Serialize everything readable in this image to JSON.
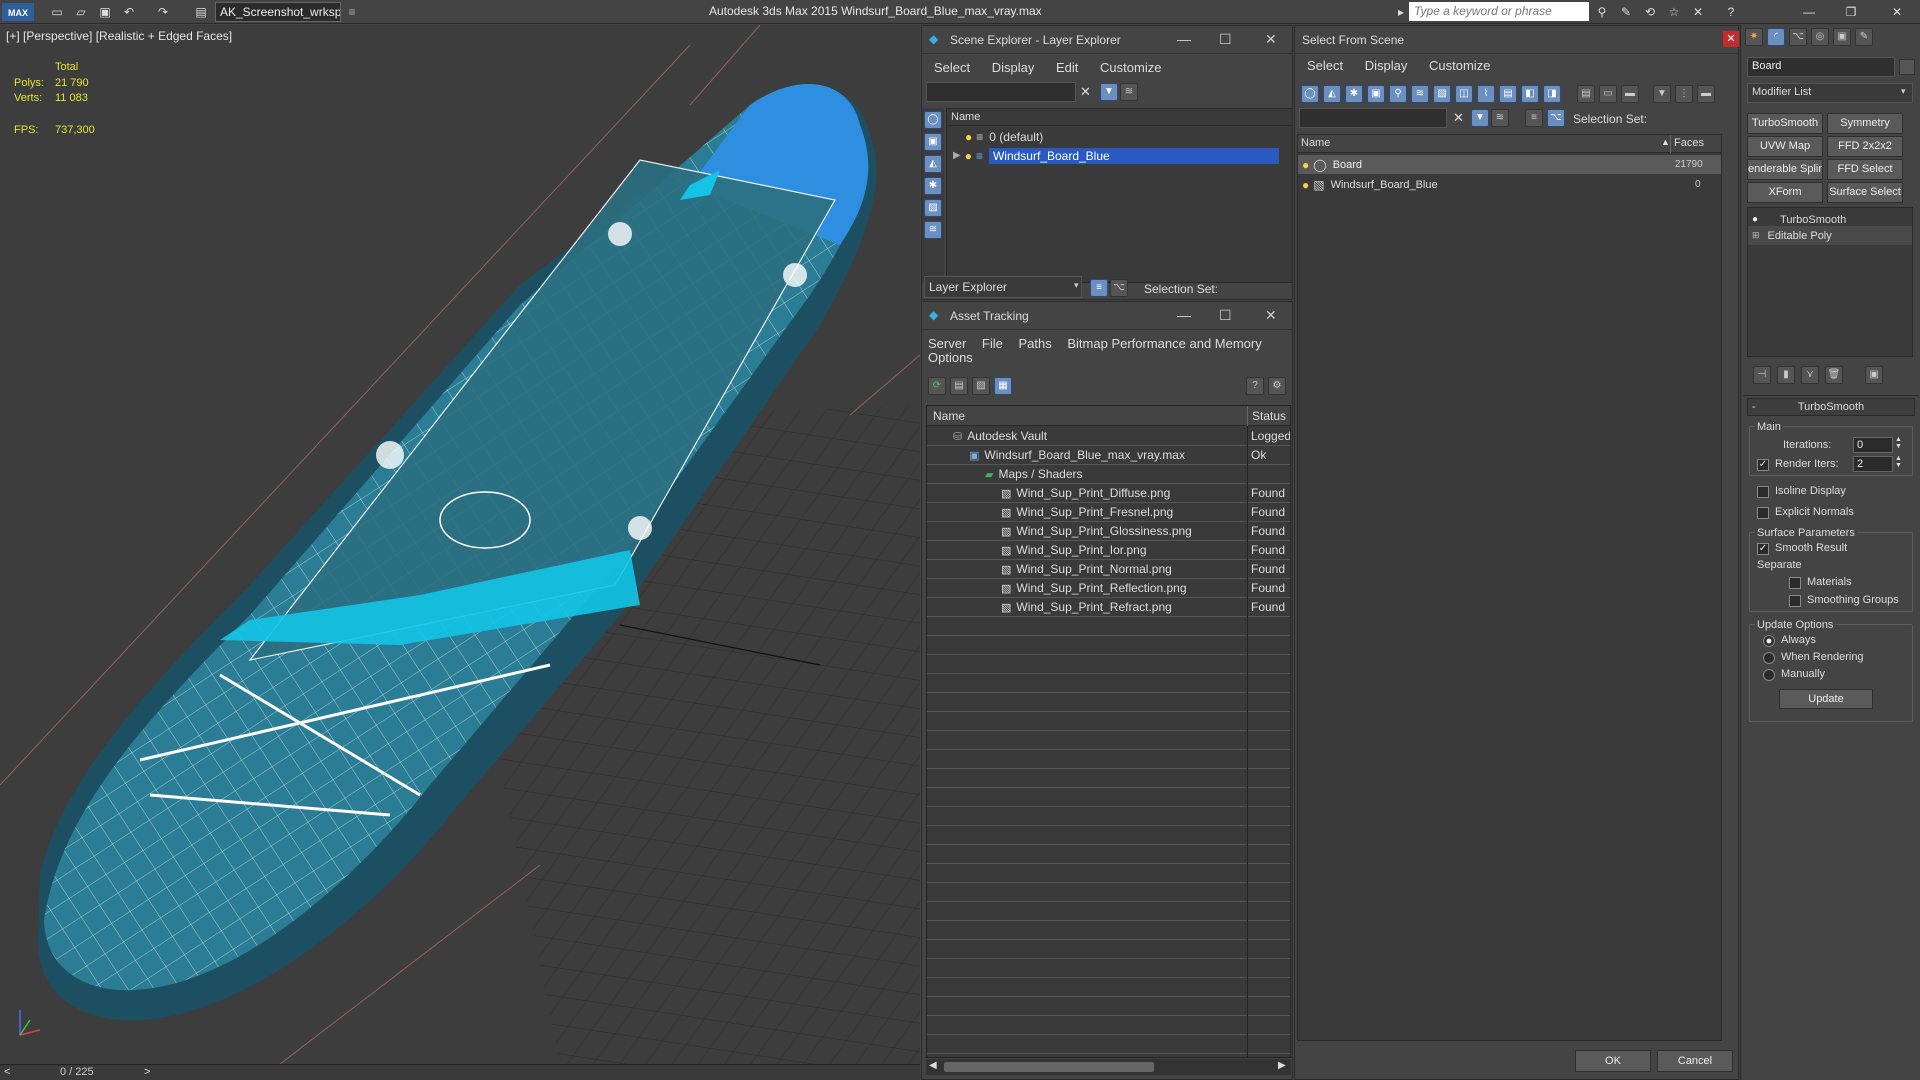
{
  "title_bar": {
    "app_logo": "MAX",
    "workspace": "AK_Screenshot_wrksp",
    "title": "Autodesk 3ds Max  2015     Windsurf_Board_Blue_max_vray.max",
    "search_placeholder": "Type a keyword or phrase"
  },
  "viewport": {
    "label": "[+] [Perspective] [Realistic + Edged Faces]",
    "stats": {
      "total_label": "Total",
      "polys_label": "Polys:",
      "polys_value": "21 790",
      "verts_label": "Verts:",
      "verts_value": "11 083",
      "fps_label": "FPS:",
      "fps_value": "737,300"
    },
    "timeline": {
      "frame": "0 / 225",
      "prev": "<",
      "next": ">"
    }
  },
  "scene_explorer": {
    "title": "Scene Explorer - Layer Explorer",
    "menu": [
      "Select",
      "Display",
      "Edit",
      "Customize"
    ],
    "column_name": "Name",
    "rows": [
      {
        "name": "0 (default)",
        "selected": false
      },
      {
        "name": "Windsurf_Board_Blue",
        "selected": true
      }
    ],
    "footer_dropdown": "Layer Explorer",
    "selection_set_label": "Selection Set:"
  },
  "asset_tracking": {
    "title": "Asset Tracking",
    "menu": [
      "Server",
      "File",
      "Paths",
      "Bitmap Performance and Memory"
    ],
    "menu2": "Options",
    "columns": {
      "name": "Name",
      "status": "Status"
    },
    "rows": [
      {
        "name": "Autodesk Vault",
        "status": "Logged",
        "level": 0,
        "icon": "vault-icon"
      },
      {
        "name": "Windsurf_Board_Blue_max_vray.max",
        "status": "Ok",
        "level": 1,
        "icon": "max-file-icon"
      },
      {
        "name": "Maps / Shaders",
        "status": "",
        "level": 2,
        "icon": "maps-icon"
      },
      {
        "name": "Wind_Sup_Print_Diffuse.png",
        "status": "Found",
        "level": 3,
        "icon": "image-file-icon"
      },
      {
        "name": "Wind_Sup_Print_Fresnel.png",
        "status": "Found",
        "level": 3,
        "icon": "image-file-icon"
      },
      {
        "name": "Wind_Sup_Print_Glossiness.png",
        "status": "Found",
        "level": 3,
        "icon": "image-file-icon"
      },
      {
        "name": "Wind_Sup_Print_Ior.png",
        "status": "Found",
        "level": 3,
        "icon": "image-file-icon"
      },
      {
        "name": "Wind_Sup_Print_Normal.png",
        "status": "Found",
        "level": 3,
        "icon": "image-file-icon"
      },
      {
        "name": "Wind_Sup_Print_Reflection.png",
        "status": "Found",
        "level": 3,
        "icon": "image-file-icon"
      },
      {
        "name": "Wind_Sup_Print_Refract.png",
        "status": "Found",
        "level": 3,
        "icon": "image-file-icon"
      }
    ]
  },
  "select_from_scene": {
    "title": "Select From Scene",
    "menu": [
      "Select",
      "Display",
      "Customize"
    ],
    "selection_set_label": "Selection Set:",
    "columns": {
      "name": "Name",
      "faces": "Faces"
    },
    "rows": [
      {
        "name": "Board",
        "faces": "21790",
        "selected": true
      },
      {
        "name": "Windsurf_Board_Blue",
        "faces": "0",
        "selected": false
      }
    ],
    "ok": "OK",
    "cancel": "Cancel"
  },
  "command_panel": {
    "object_name": "Board",
    "modifier_list": "Modifier List",
    "buttons": [
      "TurboSmooth",
      "Symmetry",
      "UVW Map",
      "FFD 2x2x2",
      "enderable Splin",
      "FFD Select",
      "XForm",
      "Surface Select"
    ],
    "stack": [
      "TurboSmooth",
      "Editable Poly"
    ],
    "rollout_title": "TurboSmooth",
    "main_label": "Main",
    "iterations_label": "Iterations:",
    "iterations_value": "0",
    "render_iters_label": "Render Iters:",
    "render_iters_value": "2",
    "isoline_label": "Isoline Display",
    "explicit_normals_label": "Explicit Normals",
    "surface_params_label": "Surface Parameters",
    "smooth_result_label": "Smooth Result",
    "separate_label": "Separate",
    "materials_label": "Materials",
    "smoothing_groups_label": "Smoothing Groups",
    "update_options_label": "Update Options",
    "always_label": "Always",
    "when_rendering_label": "When Rendering",
    "manually_label": "Manually",
    "update_button": "Update"
  }
}
